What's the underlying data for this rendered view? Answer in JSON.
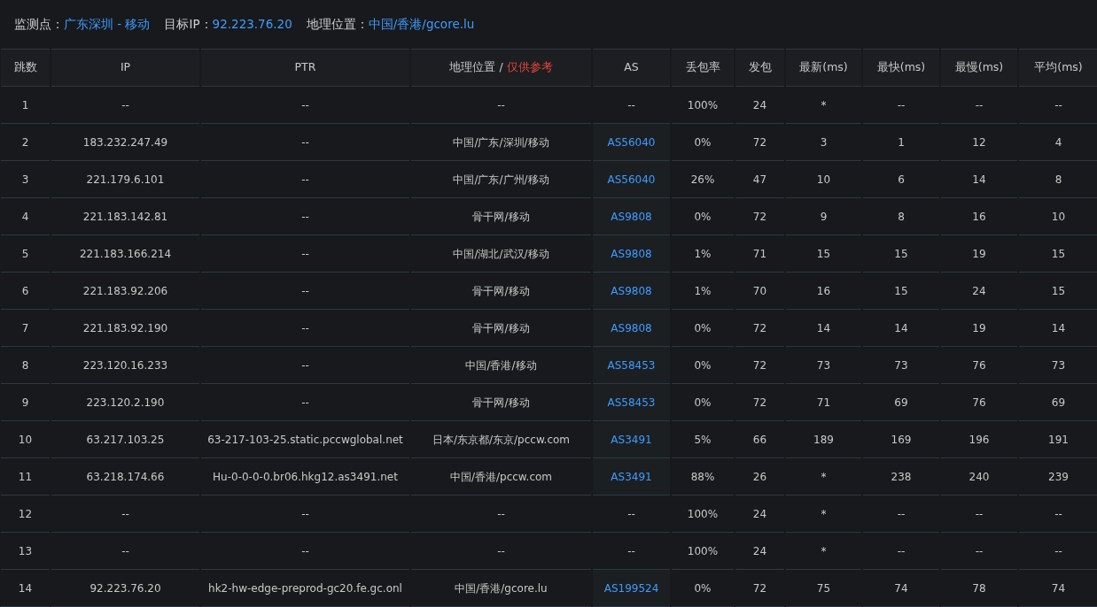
{
  "summary": [
    {
      "label": "监测点：",
      "value": "广东深圳 - 移动"
    },
    {
      "label": "目标IP：",
      "value": "92.223.76.20"
    },
    {
      "label": "地理位置：",
      "value": "中国/香港/gcore.lu"
    }
  ],
  "table": {
    "columns": [
      {
        "label": "跳数"
      },
      {
        "label": "IP"
      },
      {
        "label": "PTR"
      },
      {
        "label": "地理位置 / ",
        "note": "仅供参考"
      },
      {
        "label": "AS"
      },
      {
        "label": "丢包率"
      },
      {
        "label": "发包"
      },
      {
        "label": "最新(ms)"
      },
      {
        "label": "最快(ms)"
      },
      {
        "label": "最慢(ms)"
      },
      {
        "label": "平均(ms)"
      }
    ],
    "rows": [
      {
        "hop": "1",
        "ip": "--",
        "ptr": "--",
        "geo": "--",
        "as": {
          "text": "--",
          "link": false
        },
        "loss": "100%",
        "sent": "24",
        "latest": "*",
        "fastest": "--",
        "slowest": "--",
        "avg": "--"
      },
      {
        "hop": "2",
        "ip": "183.232.247.49",
        "ptr": "--",
        "geo": "中国/广东/深圳/移动",
        "as": {
          "text": "AS56040",
          "link": true
        },
        "loss": "0%",
        "sent": "72",
        "latest": "3",
        "fastest": "1",
        "slowest": "12",
        "avg": "4"
      },
      {
        "hop": "3",
        "ip": "221.179.6.101",
        "ptr": "--",
        "geo": "中国/广东/广州/移动",
        "as": {
          "text": "AS56040",
          "link": true
        },
        "loss": "26%",
        "sent": "47",
        "latest": "10",
        "fastest": "6",
        "slowest": "14",
        "avg": "8"
      },
      {
        "hop": "4",
        "ip": "221.183.142.81",
        "ptr": "--",
        "geo": "骨干网/移动",
        "as": {
          "text": "AS9808",
          "link": true
        },
        "loss": "0%",
        "sent": "72",
        "latest": "9",
        "fastest": "8",
        "slowest": "16",
        "avg": "10"
      },
      {
        "hop": "5",
        "ip": "221.183.166.214",
        "ptr": "--",
        "geo": "中国/湖北/武汉/移动",
        "as": {
          "text": "AS9808",
          "link": true
        },
        "loss": "1%",
        "sent": "71",
        "latest": "15",
        "fastest": "15",
        "slowest": "19",
        "avg": "15"
      },
      {
        "hop": "6",
        "ip": "221.183.92.206",
        "ptr": "--",
        "geo": "骨干网/移动",
        "as": {
          "text": "AS9808",
          "link": true
        },
        "loss": "1%",
        "sent": "70",
        "latest": "16",
        "fastest": "15",
        "slowest": "24",
        "avg": "15"
      },
      {
        "hop": "7",
        "ip": "221.183.92.190",
        "ptr": "--",
        "geo": "骨干网/移动",
        "as": {
          "text": "AS9808",
          "link": true
        },
        "loss": "0%",
        "sent": "72",
        "latest": "14",
        "fastest": "14",
        "slowest": "19",
        "avg": "14"
      },
      {
        "hop": "8",
        "ip": "223.120.16.233",
        "ptr": "--",
        "geo": "中国/香港/移动",
        "as": {
          "text": "AS58453",
          "link": true
        },
        "loss": "0%",
        "sent": "72",
        "latest": "73",
        "fastest": "73",
        "slowest": "76",
        "avg": "73"
      },
      {
        "hop": "9",
        "ip": "223.120.2.190",
        "ptr": "--",
        "geo": "骨干网/移动",
        "as": {
          "text": "AS58453",
          "link": true
        },
        "loss": "0%",
        "sent": "72",
        "latest": "71",
        "fastest": "69",
        "slowest": "76",
        "avg": "69"
      },
      {
        "hop": "10",
        "ip": "63.217.103.25",
        "ptr": "63-217-103-25.static.pccwglobal.net",
        "geo": "日本/东京都/东京/pccw.com",
        "as": {
          "text": "AS3491",
          "link": true
        },
        "loss": "5%",
        "sent": "66",
        "latest": "189",
        "fastest": "169",
        "slowest": "196",
        "avg": "191"
      },
      {
        "hop": "11",
        "ip": "63.218.174.66",
        "ptr": "Hu-0-0-0-0.br06.hkg12.as3491.net",
        "geo": "中国/香港/pccw.com",
        "as": {
          "text": "AS3491",
          "link": true
        },
        "loss": "88%",
        "sent": "26",
        "latest": "*",
        "fastest": "238",
        "slowest": "240",
        "avg": "239"
      },
      {
        "hop": "12",
        "ip": "--",
        "ptr": "--",
        "geo": "--",
        "as": {
          "text": "--",
          "link": false
        },
        "loss": "100%",
        "sent": "24",
        "latest": "*",
        "fastest": "--",
        "slowest": "--",
        "avg": "--"
      },
      {
        "hop": "13",
        "ip": "--",
        "ptr": "--",
        "geo": "--",
        "as": {
          "text": "--",
          "link": false
        },
        "loss": "100%",
        "sent": "24",
        "latest": "*",
        "fastest": "--",
        "slowest": "--",
        "avg": "--"
      },
      {
        "hop": "14",
        "ip": "92.223.76.20",
        "ptr": "hk2-hw-edge-preprod-gc20.fe.gc.onl",
        "geo": "中国/香港/gcore.lu",
        "as": {
          "text": "AS199524",
          "link": true
        },
        "loss": "0%",
        "sent": "72",
        "latest": "75",
        "fastest": "74",
        "slowest": "78",
        "avg": "74"
      }
    ]
  }
}
